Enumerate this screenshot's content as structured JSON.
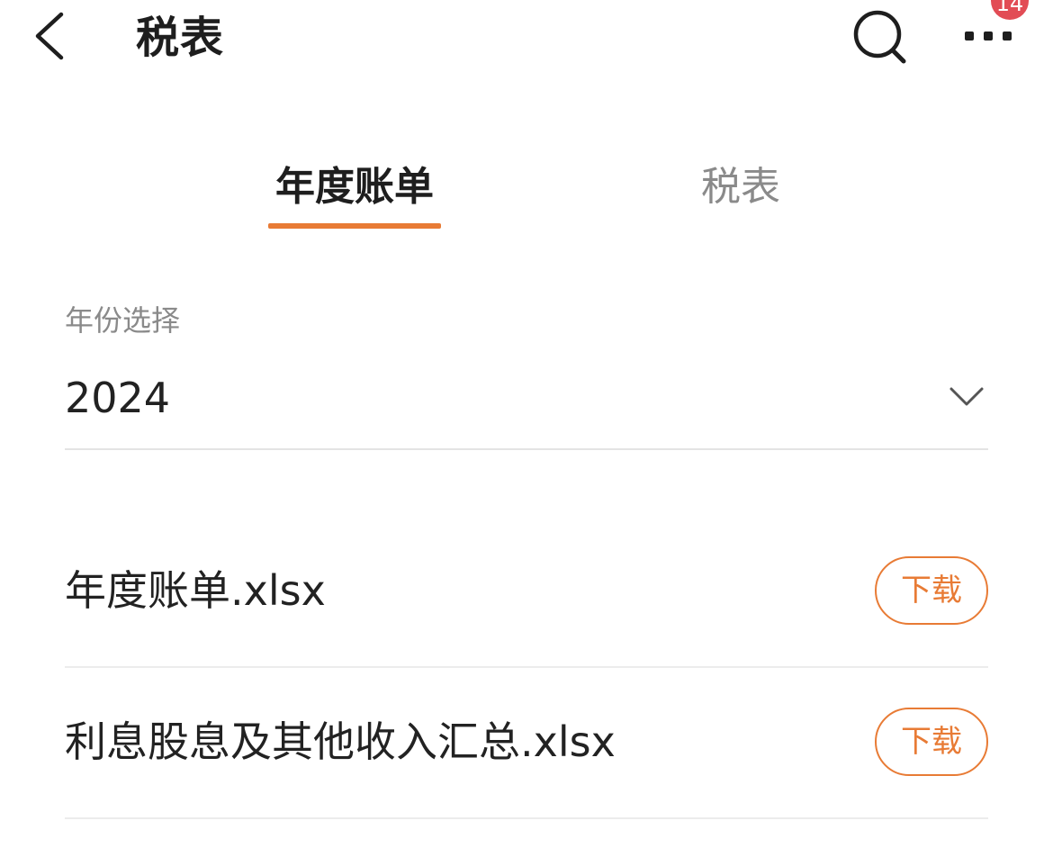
{
  "header": {
    "title": "税表",
    "back_icon": "chevron-left-icon",
    "search_icon": "search-icon",
    "more_icon": "more-horizontal-icon",
    "notification_count": "14",
    "badge_color": "#e24c55"
  },
  "tabs": [
    {
      "label": "年度账单",
      "active": true
    },
    {
      "label": "税表",
      "active": false
    }
  ],
  "year_selector": {
    "label": "年份选择",
    "value": "2024",
    "dropdown_icon": "chevron-down-icon"
  },
  "files": [
    {
      "name": "年度账单.xlsx",
      "action_label": "下载"
    },
    {
      "name": "利息股息及其他收入汇总.xlsx",
      "action_label": "下载"
    }
  ],
  "colors": {
    "accent": "#e87b35",
    "text_primary": "#222222",
    "text_secondary": "#8a8a8a"
  }
}
